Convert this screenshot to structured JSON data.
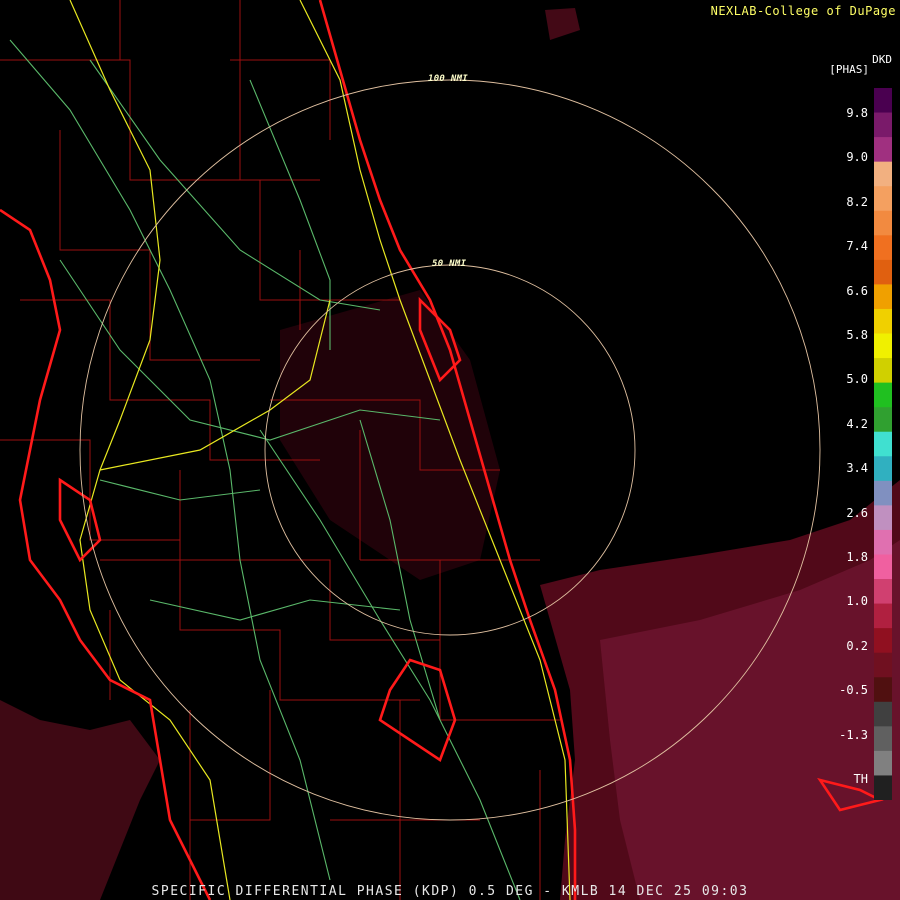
{
  "header": {
    "credit": "NEXLAB-College of DuPage"
  },
  "legend": {
    "product_code": "DKD",
    "unit": "[PHAS]",
    "labels": [
      "9.8",
      "9.0",
      "8.2",
      "7.4",
      "6.6",
      "5.8",
      "5.0",
      "4.2",
      "3.4",
      "2.6",
      "1.8",
      "1.0",
      "0.2",
      "-0.5",
      "-1.3",
      "TH"
    ],
    "colors": [
      "#4a0050",
      "#7a1a6a",
      "#a03080",
      "#f2b080",
      "#f4a060",
      "#f28a40",
      "#f07020",
      "#e06010",
      "#f0a000",
      "#f0d000",
      "#f0f000",
      "#d0d000",
      "#20c020",
      "#30a030",
      "#40e0d0",
      "#30b0c0",
      "#8090c0",
      "#c090c0",
      "#e070b0",
      "#f060a0",
      "#d04070",
      "#b02040",
      "#901020",
      "#701020",
      "#501010",
      "#404040",
      "#606060",
      "#808080",
      "#202020"
    ]
  },
  "range_rings": [
    {
      "label": "100 NMI"
    },
    {
      "label": "50 NMI"
    }
  ],
  "caption": "SPECIFIC DIFFERENTIAL PHASE (KDP) 0.5 DEG - KMLB 14 DEC 25 09:03"
}
